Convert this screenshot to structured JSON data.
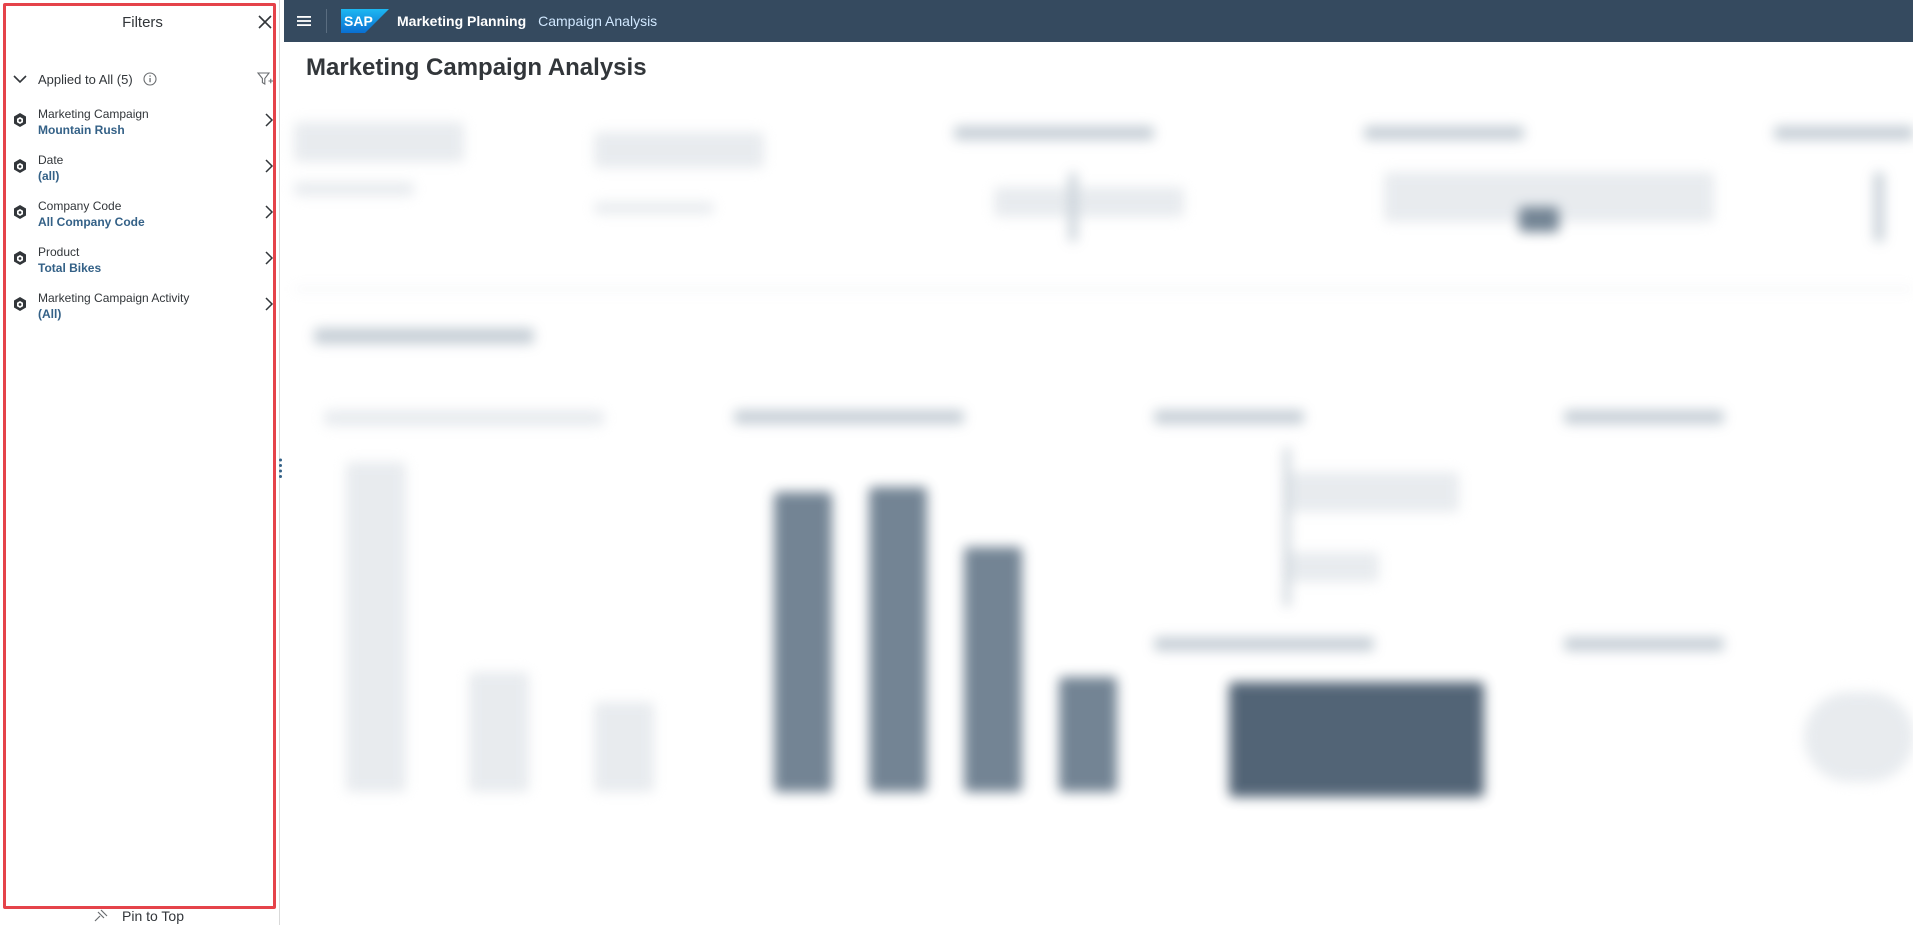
{
  "filters_panel": {
    "title": "Filters",
    "applied_label": "Applied to All (5)",
    "items": [
      {
        "name": "Marketing Campaign",
        "value": "Mountain Rush"
      },
      {
        "name": "Date",
        "value": "(all)"
      },
      {
        "name": "Company Code",
        "value": "All Company Code"
      },
      {
        "name": "Product",
        "value": "Total Bikes"
      },
      {
        "name": "Marketing Campaign Activity",
        "value": "(All)"
      }
    ],
    "pin_label": "Pin to Top"
  },
  "shell": {
    "logo": "SAP",
    "app_name": "Marketing Planning",
    "page_name": "Campaign Analysis"
  },
  "main": {
    "page_title": "Marketing Campaign Analysis"
  },
  "colors": {
    "shell_bg": "#354a5f",
    "highlight_border": "#e5434a",
    "value_link": "#346187",
    "chart_dark": "#354a5f"
  },
  "icons": {
    "close": "close-icon",
    "menu": "hamburger-menu-icon",
    "expand": "chevron-down-icon",
    "info": "info-icon",
    "filter": "filter-funnel-icon",
    "dimension": "cube-dimension-icon",
    "drilldown": "chevron-right-icon",
    "pin": "pin-icon"
  }
}
